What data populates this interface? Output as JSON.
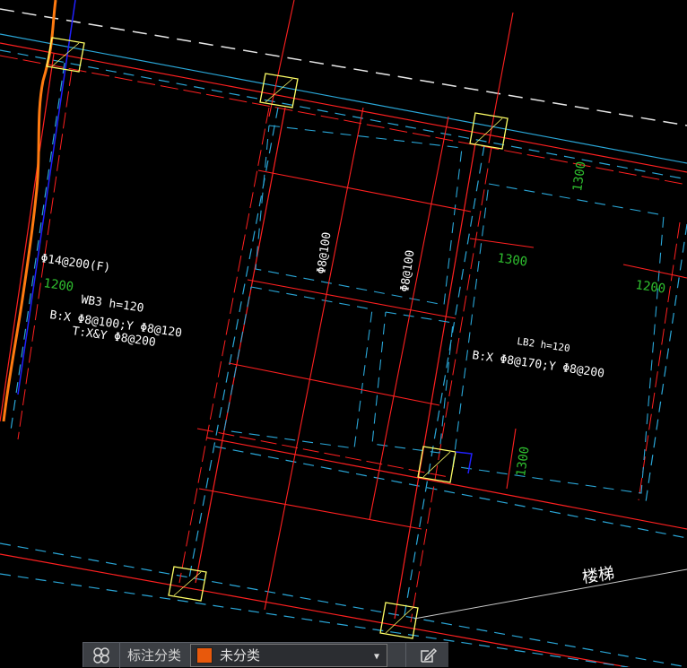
{
  "drawing": {
    "slab_rebar_top_left": "Φ14@200(F)",
    "dim_1200_left": "1200",
    "slab_wb3_name": "WB3   h=120",
    "slab_wb3_bottom": "B:X Φ8@100;Y   Φ8@120",
    "slab_wb3_top": "T:X&Y Φ8@200",
    "rebar_vertical_1": "Φ8@100",
    "rebar_vertical_2": "Φ8@100",
    "dim_1300_top_right": "1300",
    "dim_1300_mid": "1300",
    "dim_1200_right": "1200",
    "slab_lb2_name": "LB2    h=120",
    "slab_lb2_bottom": "B:X Φ8@170;Y   Φ8@200",
    "dim_1300_lower": "1300",
    "stair_label": "楼梯"
  },
  "toolbar": {
    "label": "标注分类",
    "selected_category": "未分类",
    "selected_color": "#e8590c"
  },
  "colors": {
    "background": "#000000",
    "beam_red": "#ff2020",
    "beam_cyan": "#2aa7d8",
    "column_yellow": "#ffff66",
    "dim_green": "#2fbf2f",
    "pipe_orange": "#ff7a10"
  }
}
